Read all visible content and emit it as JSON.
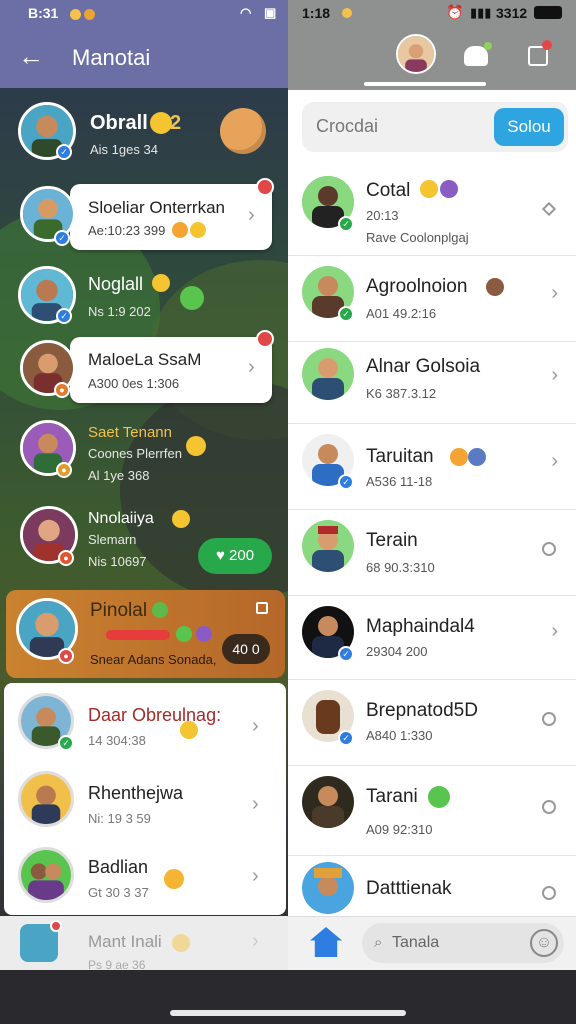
{
  "left": {
    "status": {
      "time": "B:31"
    },
    "header": {
      "title": "Manotai",
      "back_icon": "arrow-left-icon"
    },
    "chats": [
      {
        "name": "Obrall",
        "sub": "Ais 1ges 34",
        "emoji_text": "2"
      },
      {
        "name": "Sloeliar Onterrkan",
        "sub": "Ae:10:23 399"
      },
      {
        "name": "Noglall",
        "sub": "Ns 1:9 202"
      },
      {
        "name": "MaloeLa SsaM",
        "sub": "A300 0es 1:306"
      },
      {
        "name": "Saet Tenann",
        "sub": "Coones Plerrfen",
        "sub2": "Al 1ye 368"
      },
      {
        "name": "Nnolaiiya",
        "sub": "Slemarn",
        "sub2": "Nis 10697",
        "pill": "200"
      },
      {
        "name": "Pinolal",
        "sub": "Snear Adans Sonada,",
        "pill": "40 0"
      },
      {
        "name": "Daar Obreulnag:",
        "sub": "14 304:38"
      },
      {
        "name": "Rhenthejwa",
        "sub": "Ni: 19 3 59"
      },
      {
        "name": "Badlian",
        "sub": "Gt 30 3 37"
      }
    ],
    "bottom": {
      "name": "Mant Inali",
      "sub": "Ps 9 ae 36"
    }
  },
  "right": {
    "status": {
      "time": "1:18",
      "right": "3312"
    },
    "search": {
      "placeholder": "Crocdai",
      "button": "Solou"
    },
    "chats": [
      {
        "name": "Cotal",
        "sub": "20:13",
        "sub2": "Rave Coolonplgaj"
      },
      {
        "name": "Agroolnoion",
        "sub": "A01 49.2:16"
      },
      {
        "name": "Alnar Golsoia",
        "sub": "K6 387.3.12"
      },
      {
        "name": "Taruitan",
        "sub": "A536 11-18"
      },
      {
        "name": "Terain",
        "sub": "68 90.3:310"
      },
      {
        "name": "Maphaindal4",
        "sub": "29304 200"
      },
      {
        "name": "Brepnatod5D",
        "sub": "A840 1:330"
      },
      {
        "name": "Tarani",
        "sub": "A09 92:310"
      },
      {
        "name": "Datttienak",
        "sub": ""
      }
    ],
    "bottom": {
      "search_placeholder": "Tanala"
    }
  },
  "colors": {
    "header_purple": "#6b6fa6",
    "accent_blue": "#2ea4e0",
    "green_pill": "#27a84a",
    "orange_row": "#c9822f"
  }
}
